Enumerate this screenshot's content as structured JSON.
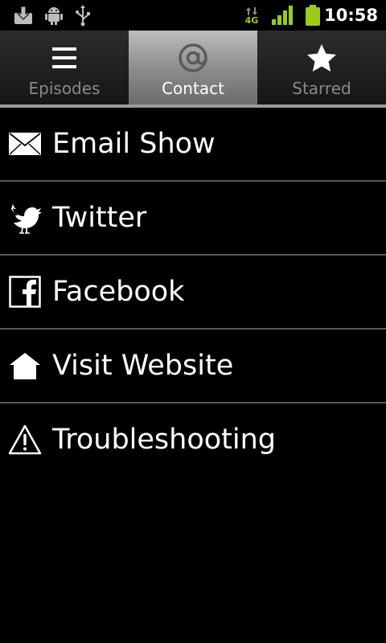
{
  "status_bar": {
    "time": "10:58",
    "network_label": "4G",
    "icons": [
      "download-icon",
      "android-debug-icon",
      "usb-icon",
      "network-4g-icon",
      "signal-icon",
      "battery-icon"
    ],
    "accent_green": "#9ccc1a"
  },
  "tabs": [
    {
      "label": "Episodes",
      "icon": "list-icon",
      "active": false
    },
    {
      "label": "Contact",
      "icon": "at-sign-icon",
      "active": true
    },
    {
      "label": "Starred",
      "icon": "star-icon",
      "active": false
    }
  ],
  "menu": {
    "items": [
      {
        "label": "Email Show",
        "icon": "envelope-icon"
      },
      {
        "label": "Twitter",
        "icon": "twitter-bird-icon"
      },
      {
        "label": "Facebook",
        "icon": "facebook-icon"
      },
      {
        "label": "Visit Website",
        "icon": "home-icon"
      },
      {
        "label": "Troubleshooting",
        "icon": "warning-icon"
      }
    ]
  }
}
